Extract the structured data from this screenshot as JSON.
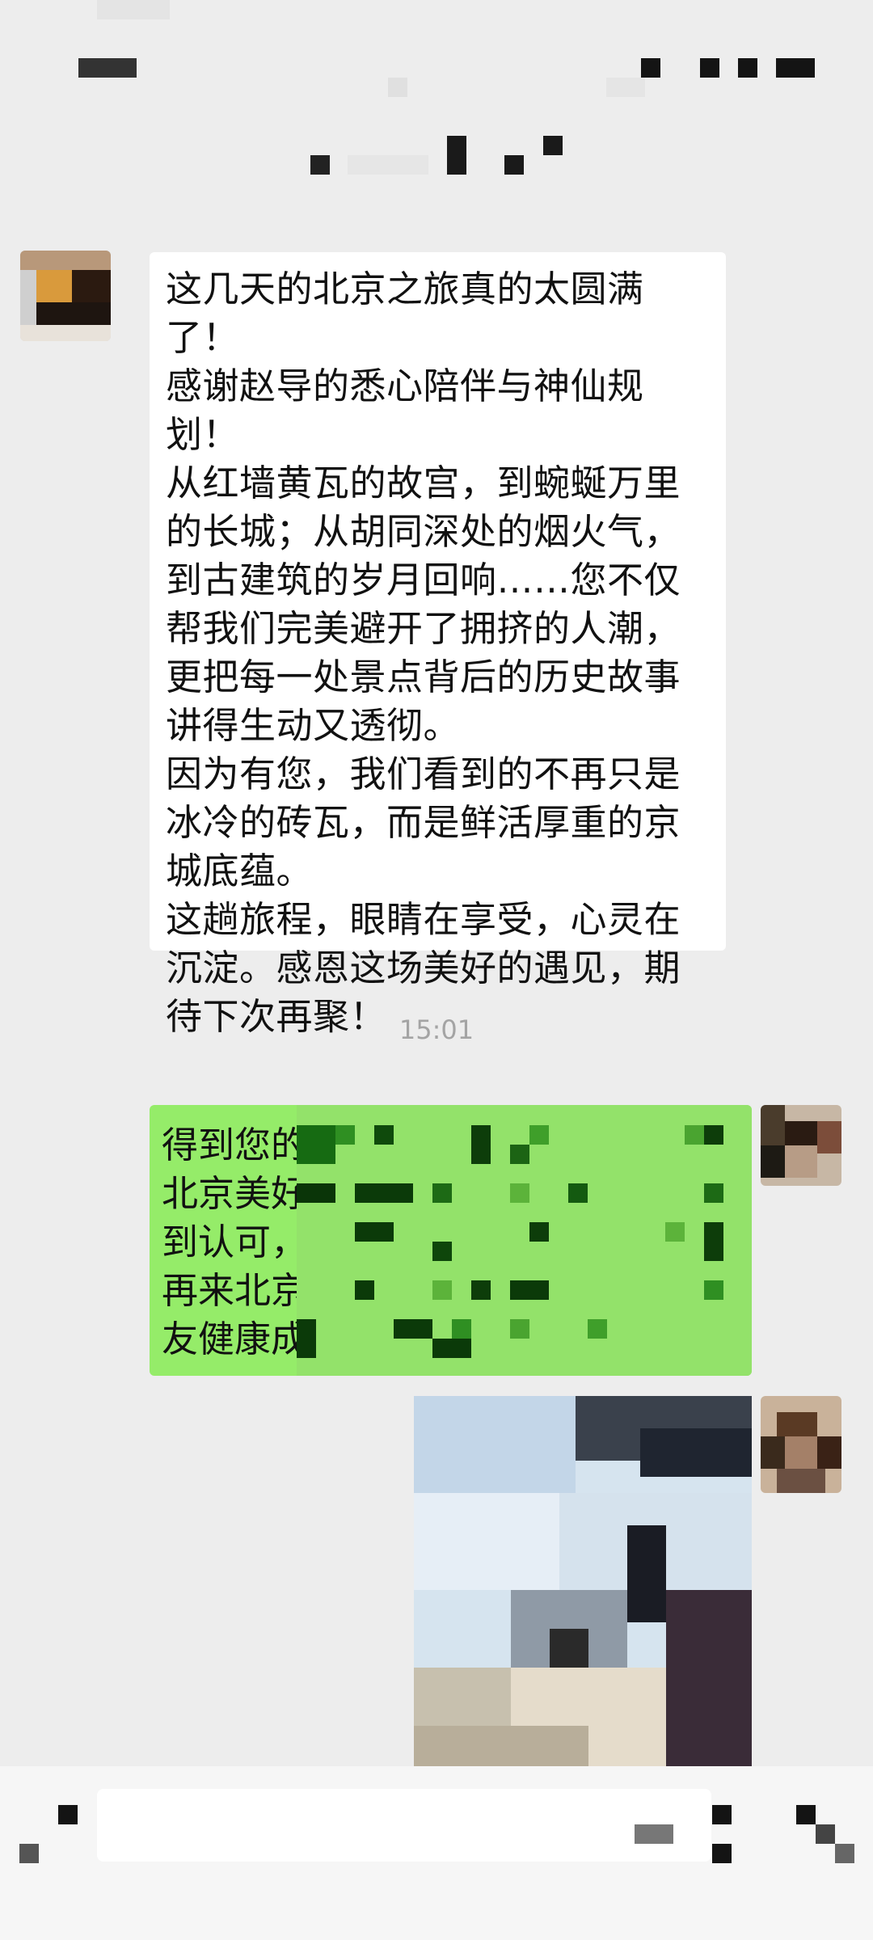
{
  "chat": {
    "incoming_message": "这几天的北京之旅真的太圆满了！\n感谢赵导的悉心陪伴与神仙规划！\n从红墙黄瓦的故宫，到蜿蜒万里的长城；从胡同深处的烟火气，到古建筑的岁月回响……您不仅帮我们完美避开了拥挤的人潮，更把每一处景点背后的历史故事讲得生动又透彻。\n因为有您，我们看到的不再只是冰冷的砖瓦，而是鲜活厚重的京城底蕴。\n这趟旅程，眼睛在享受，心灵在沉淀。感恩这场美好的遇见，期待下次再聚！",
    "timestamp": "15:01",
    "outgoing_message_visible": "得到您的\n北京美好\n到认可，\n再来北京\n友健康成"
  },
  "colors": {
    "background": "#ededed",
    "incoming_bubble": "#ffffff",
    "outgoing_bubble": "#95ec69",
    "timestamp_text": "#a4a4a4"
  },
  "icons": {
    "back": "back-arrow-icon",
    "more": "more-icon",
    "voice": "voice-icon",
    "emoji": "emoji-icon",
    "add": "plus-icon"
  }
}
